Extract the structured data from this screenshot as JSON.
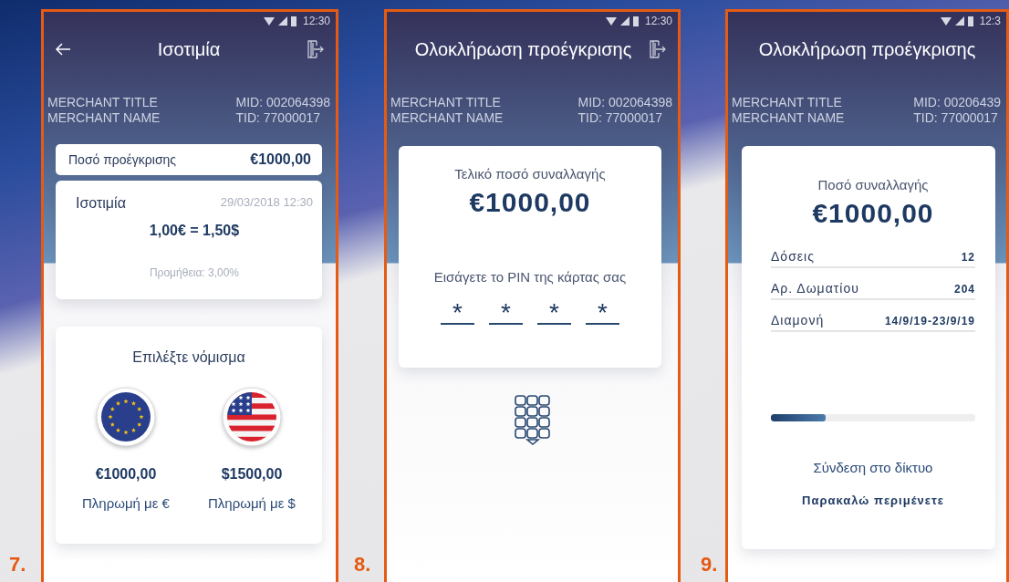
{
  "screens": [
    {
      "label": "7.",
      "kind": "exchange",
      "status_bar": {
        "time": "12:30"
      },
      "header": {
        "title": "Ισοτιμία",
        "back": true,
        "exit": true
      },
      "merchant": {
        "title": "MERCHANT TITLE",
        "name": "MERCHANT NAME",
        "mid": "MID: 002064398",
        "tid": "TID: 77000017"
      },
      "approval": {
        "label": "Ποσό προέγκρισης",
        "amount": "€1000,00"
      },
      "rate": {
        "title": "Ισοτιμία",
        "date": "29/03/2018 12:30",
        "rate": "1,00€ = 1,50$",
        "commission": "Προμήθεια: 3,00%"
      },
      "currency": {
        "heading": "Επιλέξτε νόμισμα",
        "options": [
          {
            "kind": "eu",
            "amount": "€1000,00",
            "action": "Πληρωμή με €"
          },
          {
            "kind": "us",
            "amount": "$1500,00",
            "action": "Πληρωμή με $"
          }
        ]
      }
    },
    {
      "label": "8.",
      "kind": "pin",
      "status_bar": {
        "time": "12:30"
      },
      "header": {
        "title": "Ολοκλήρωση προέγκρισης",
        "back": false,
        "exit": true
      },
      "merchant": {
        "title": "MERCHANT TITLE",
        "name": "MERCHANT NAME",
        "mid": "MID: 002064398",
        "tid": "TID: 77000017"
      },
      "card": {
        "label": "Τελικό ποσό συναλλαγής",
        "amount": "€1000,00",
        "prompt": "Εισάγετε το PIN της κάρτας σας",
        "pin": [
          "*",
          "*",
          "*",
          "*"
        ]
      }
    },
    {
      "label": "9.",
      "kind": "processing",
      "status_bar": {
        "time": "12:3"
      },
      "header": {
        "title": "Ολοκλήρωση προέγκρισης",
        "back": false,
        "exit": false
      },
      "merchant": {
        "title": "MERCHANT TITLE",
        "name": "MERCHANT NAME",
        "mid": "MID: 00206439",
        "tid": "TID: 77000017"
      },
      "card": {
        "label": "Ποσό συναλλαγής",
        "amount": "€1000,00",
        "details": [
          {
            "label": "Δόσεις",
            "value": "12"
          },
          {
            "label": "Αρ. Δωματίου",
            "value": "204"
          },
          {
            "label": "Διαμονή",
            "value": "14/9/19-23/9/19"
          }
        ],
        "progress": {
          "level": 0.27
        },
        "status": "Σύνδεση στο δίκτυο",
        "message": "Παρακαλώ περιμένετε"
      }
    }
  ]
}
